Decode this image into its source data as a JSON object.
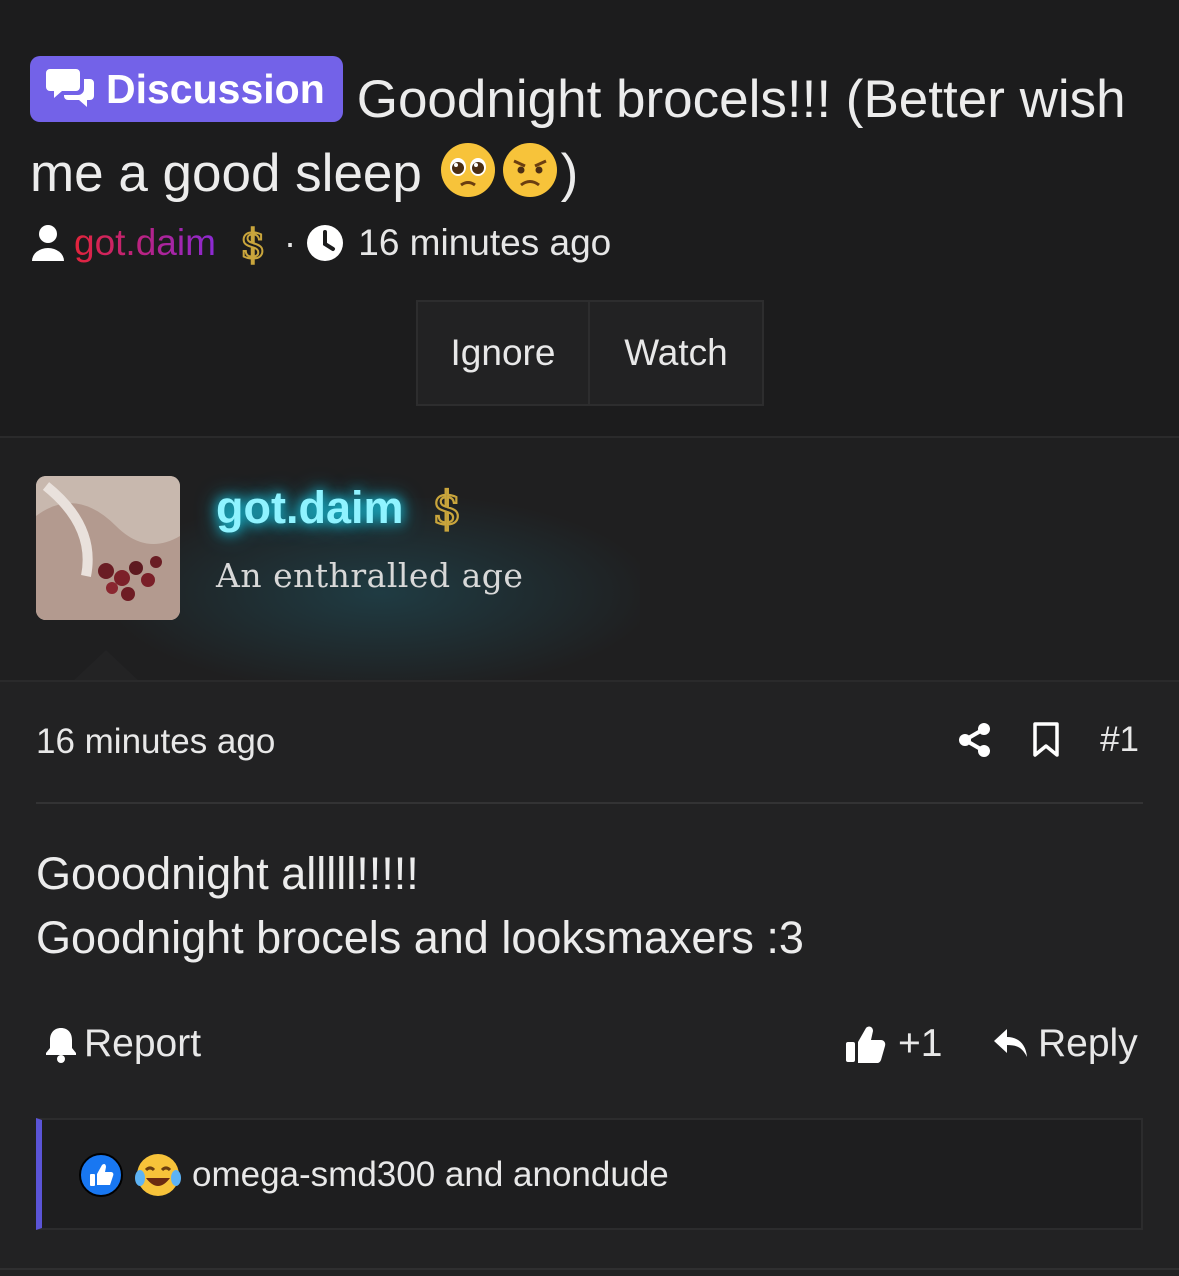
{
  "thread": {
    "badge_label": "Discussion",
    "title_line": "Goodnight brocels!!! (Better wish me a good sleep ",
    "title_close": ")",
    "author": "got.daim",
    "time": "16 minutes ago",
    "buttons": {
      "ignore": "Ignore",
      "watch": "Watch"
    }
  },
  "author_card": {
    "name": "got.daim",
    "tagline": "An enthralled age"
  },
  "post": {
    "time": "16 minutes ago",
    "number": "#1",
    "body_line1": "Gooodnight alllll!!!!!",
    "body_line2": "Goodnight brocels and looksmaxers :3",
    "report_label": "Report",
    "like_count": "+1",
    "reply_label": "Reply",
    "reactions_text": "omega-smd300 and anondude"
  },
  "colors": {
    "badge": "#7362e8",
    "author_glow": "#19d2ec",
    "reaction_bar": "#5b54d6"
  }
}
